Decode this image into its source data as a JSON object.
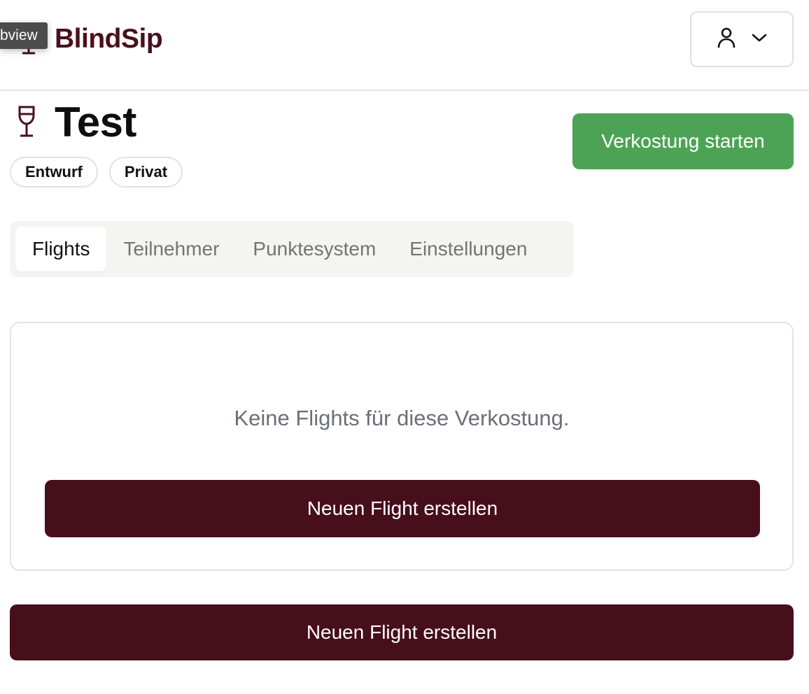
{
  "header": {
    "tooltip": "bview",
    "brand_name": "BlindSip",
    "brand_icon": "wine-glass-icon",
    "user_icon": "user-icon",
    "menu_icon": "chevron-down-icon"
  },
  "tasting": {
    "title": "Test",
    "title_icon": "wine-glass-icon",
    "badges": [
      "Entwurf",
      "Privat"
    ],
    "start_label": "Verkostung starten"
  },
  "tabs": {
    "items": [
      "Flights",
      "Teilnehmer",
      "Punktesystem",
      "Einstellungen"
    ],
    "active": "Flights"
  },
  "flights": {
    "empty_message": "Keine Flights für diese Verkostung.",
    "create_label": "Neuen Flight erstellen",
    "create_label_bottom": "Neuen Flight erstellen"
  },
  "colors": {
    "brand": "#4a0f1d",
    "primary_button": "#470e1b",
    "start_button": "#4da355",
    "muted_text": "#6b6f78"
  }
}
